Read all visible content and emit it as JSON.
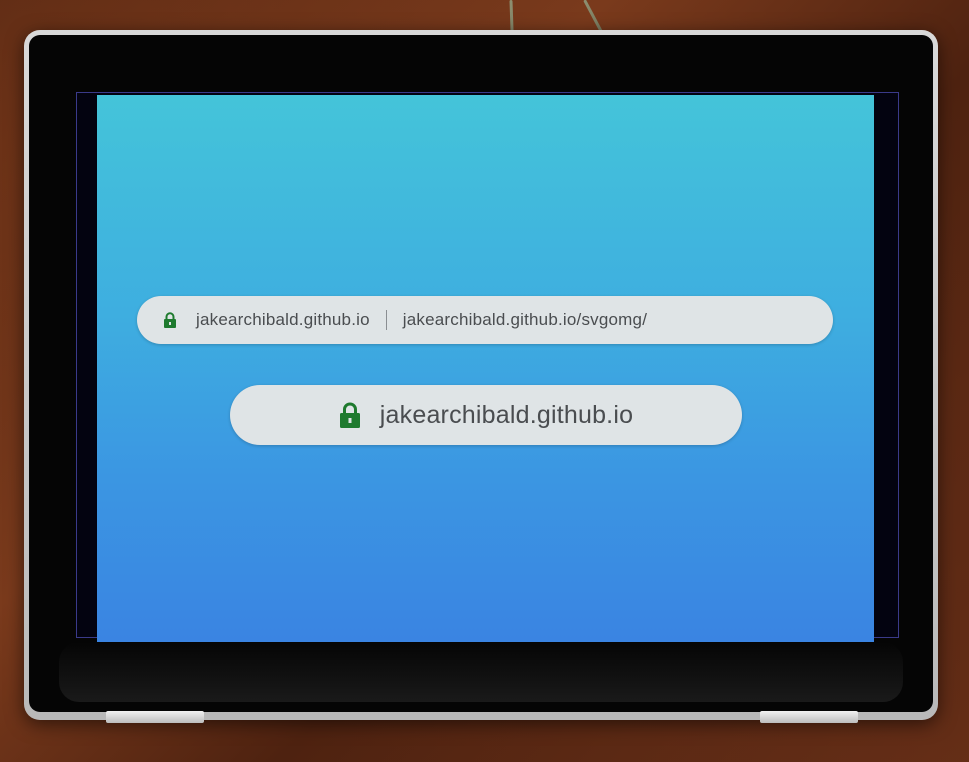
{
  "colors": {
    "lock": "#1e7a2e",
    "omnibox_bg": "#dfe4e6",
    "text": "#4a4d50",
    "screen_top": "#44c4d9",
    "screen_bottom": "#3a84e2"
  },
  "omnibox_full": {
    "icon": "lock-icon",
    "host": "jakearchibald.github.io",
    "url": "jakearchibald.github.io/svgomg/"
  },
  "omnibox_simplified": {
    "icon": "lock-icon",
    "host": "jakearchibald.github.io"
  }
}
